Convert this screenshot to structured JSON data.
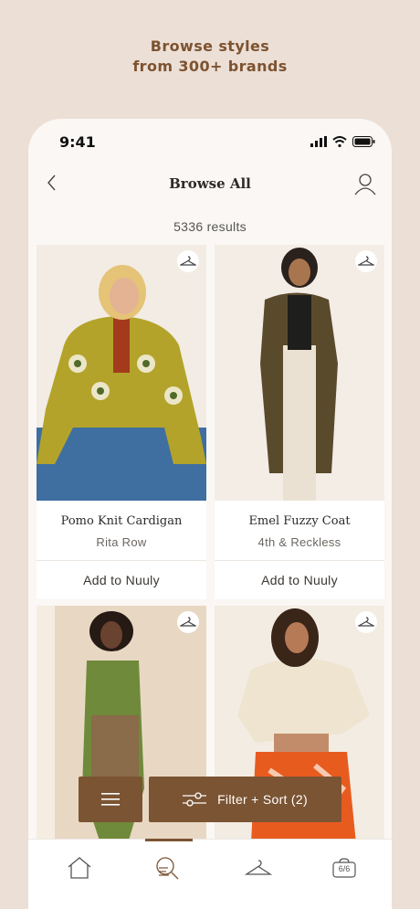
{
  "promo": {
    "line1": "Browse styles",
    "line2": "from 300+ brands"
  },
  "status_bar": {
    "time": "9:41"
  },
  "navbar": {
    "title": "Browse All",
    "back_icon": "chevron-left-icon",
    "account_icon": "user-icon"
  },
  "results": {
    "label": "5336 results"
  },
  "products": [
    {
      "name": "Pomo Knit Cardigan",
      "brand": "Rita Row",
      "action": "Add to Nuuly"
    },
    {
      "name": "Emel Fuzzy Coat",
      "brand": "4th & Reckless",
      "action": "Add to Nuuly"
    },
    {
      "name": "",
      "brand": "",
      "action": ""
    },
    {
      "name": "",
      "brand": "",
      "action": ""
    }
  ],
  "filter_bar": {
    "filter_label": "Filter + Sort (2)"
  },
  "tabbar": {
    "tabs": [
      {
        "icon": "home-icon"
      },
      {
        "icon": "browse-search-icon",
        "active": true
      },
      {
        "icon": "hanger-icon"
      },
      {
        "icon": "rack-icon",
        "badge": "6/6"
      }
    ]
  },
  "colors": {
    "accent": "#7b5433",
    "background": "#ecdfd6",
    "surface": "#faf7f4"
  }
}
